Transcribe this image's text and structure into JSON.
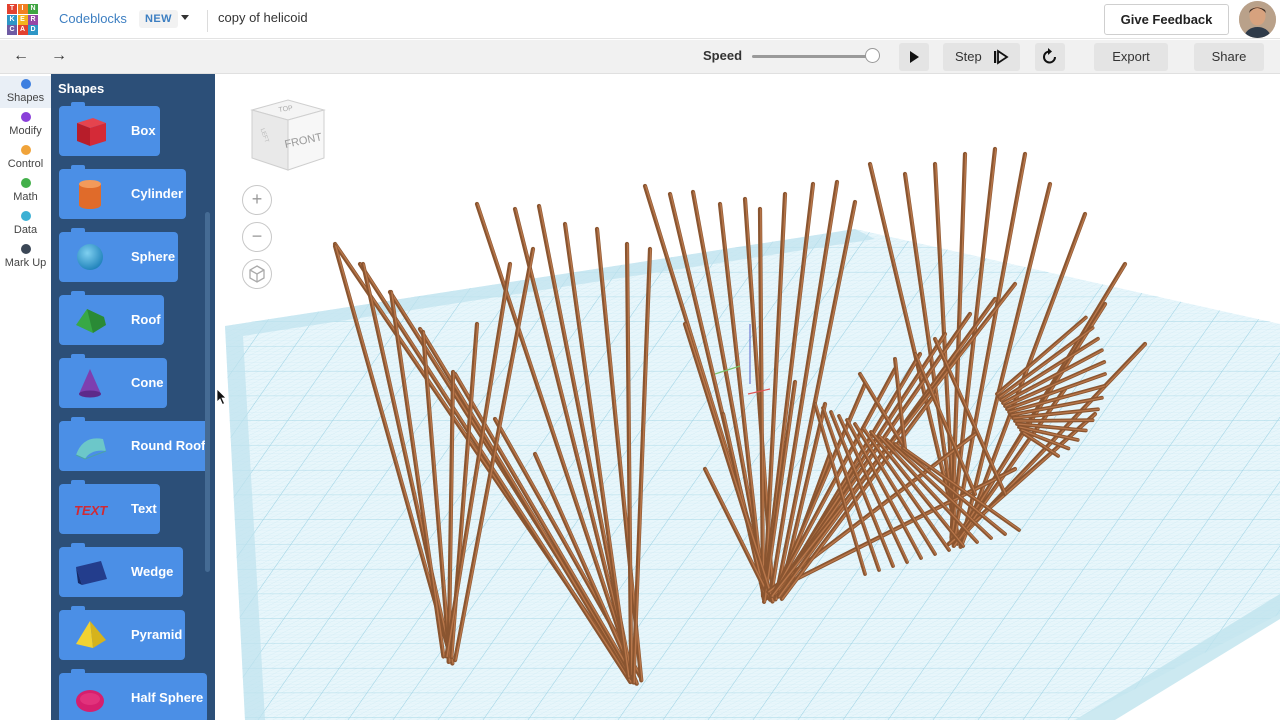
{
  "app": {
    "logo_letters": [
      "T",
      "I",
      "N",
      "K",
      "E",
      "R",
      "C",
      "A",
      "D"
    ],
    "logo_colors": [
      "#e2412f",
      "#f17e23",
      "#3fa442",
      "#2d96c6",
      "#f3b41d",
      "#9648a6",
      "#6e5ba3",
      "#e2412f",
      "#2d96c6"
    ],
    "name": "Codeblocks",
    "badge": "NEW",
    "design_name": "copy of helicoid",
    "feedback_label": "Give Feedback"
  },
  "toolbar": {
    "undo_icon": "←",
    "redo_icon": "→",
    "speed_label": "Speed",
    "speed_value": 0.93,
    "play_icon": "play-icon",
    "step_label": "Step",
    "step_icon": "step-icon",
    "reset_icon": "reset-icon",
    "export_label": "Export",
    "share_label": "Share"
  },
  "categories": [
    {
      "label": "Shapes",
      "color": "#3d7fe0",
      "active": true
    },
    {
      "label": "Modify",
      "color": "#8a3fd9",
      "active": false
    },
    {
      "label": "Control",
      "color": "#f0a33a",
      "active": false
    },
    {
      "label": "Math",
      "color": "#43b04a",
      "active": false
    },
    {
      "label": "Data",
      "color": "#3cb0d4",
      "active": false
    },
    {
      "label": "Mark Up",
      "color": "#3b4756",
      "active": false
    }
  ],
  "shapes_panel": {
    "title": "Shapes",
    "blocks": [
      {
        "label": "Box",
        "icon": "box-icon"
      },
      {
        "label": "Cylinder",
        "icon": "cylinder-icon"
      },
      {
        "label": "Sphere",
        "icon": "sphere-icon"
      },
      {
        "label": "Roof",
        "icon": "roof-icon"
      },
      {
        "label": "Cone",
        "icon": "cone-icon"
      },
      {
        "label": "Round Roof",
        "icon": "round-roof-icon"
      },
      {
        "label": "Text",
        "icon": "text-shape-icon"
      },
      {
        "label": "Wedge",
        "icon": "wedge-icon"
      },
      {
        "label": "Pyramid",
        "icon": "pyramid-icon"
      },
      {
        "label": "Half Sphere",
        "icon": "half-sphere-icon"
      }
    ]
  },
  "viewcube": {
    "top": "TOP",
    "front": "FRONT",
    "left": "LEFT"
  },
  "view_controls": {
    "zoom_in": "+",
    "zoom_out": "−",
    "home_icon": "home-view-icon"
  },
  "scene": {
    "grid_color": "#a8dbe9",
    "rod_color": "#8a5530",
    "rod_highlight": "#b8764a"
  }
}
